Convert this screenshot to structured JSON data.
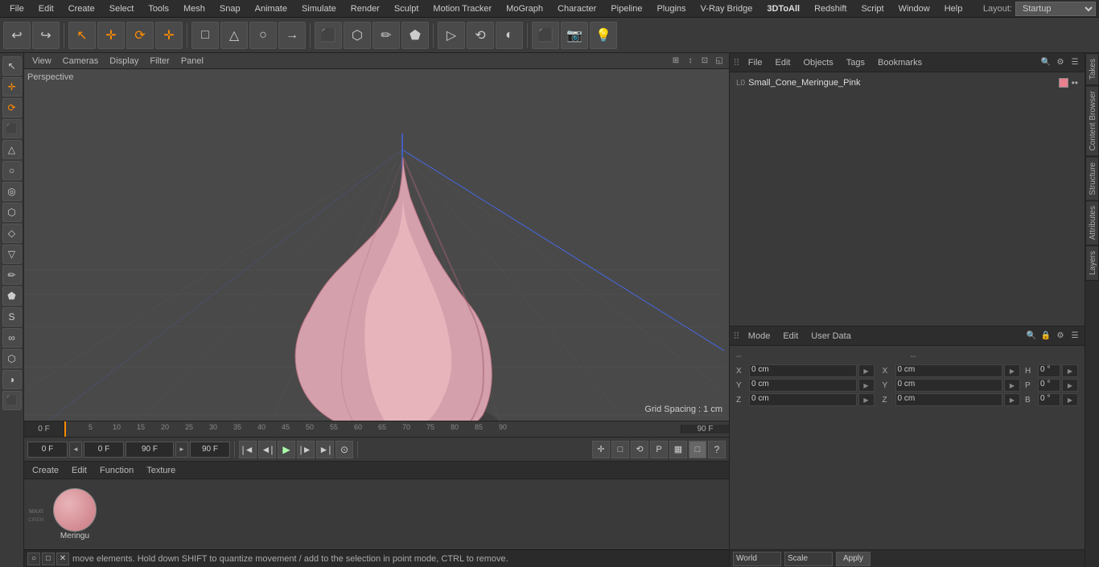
{
  "menubar": {
    "items": [
      "File",
      "Edit",
      "Create",
      "Select",
      "Tools",
      "Mesh",
      "Snap",
      "Animate",
      "Simulate",
      "Render",
      "Sculpt",
      "Motion Tracker",
      "MoGraph",
      "Character",
      "Pipeline",
      "Plugins",
      "V-Ray Bridge",
      "3DToAll",
      "Redshift",
      "Script",
      "Window",
      "Help"
    ],
    "layout_label": "Layout:",
    "layout_value": "Startup"
  },
  "toolbar": {
    "buttons": [
      "↩",
      "↪",
      "↖",
      "✛",
      "⟳",
      "✛",
      "□",
      "△",
      "○",
      "→",
      "⬛",
      "⬡",
      "✏",
      "⬟",
      "◈",
      "▷",
      "⟲",
      "◐",
      "☆",
      "⬛",
      "⬡",
      "◇",
      "▦",
      "📷",
      "💡"
    ]
  },
  "left_sidebar": {
    "buttons": [
      "↖",
      "✛",
      "⟳",
      "⬛",
      "△",
      "○",
      "◎",
      "⬡",
      "◇",
      "▽",
      "✏",
      "⬟",
      "S",
      "∞",
      "⬡",
      "◑",
      "⬛"
    ]
  },
  "viewport": {
    "label": "Perspective",
    "menu_items": [
      "View",
      "Cameras",
      "Display",
      "Filter",
      "Panel"
    ],
    "grid_spacing": "Grid Spacing : 1 cm"
  },
  "timeline": {
    "ticks": [
      0,
      5,
      10,
      15,
      20,
      25,
      30,
      35,
      40,
      45,
      50,
      55,
      60,
      65,
      70,
      75,
      80,
      85,
      90
    ],
    "current_frame_label": "0 F",
    "end_frame": "90 F"
  },
  "playback": {
    "start_frame": "0 F",
    "current_frame": "0 F",
    "end_frame": "90 F",
    "end_frame2": "90 F",
    "right_icons": [
      "⊞",
      "□",
      "⊡",
      "⊙",
      "P",
      "▦",
      "□"
    ]
  },
  "objects_panel": {
    "toolbar_items": [
      "File",
      "Edit",
      "Objects",
      "Tags",
      "Bookmarks"
    ],
    "scene_object": {
      "icon": "L0",
      "name": "Small_Cone_Meringue_Pink",
      "color": "#e88090"
    }
  },
  "attributes_panel": {
    "toolbar_items": [
      "Mode",
      "Edit",
      "User Data"
    ],
    "coord_headers": [
      "--",
      "--"
    ],
    "fields": {
      "x_pos": "0 cm",
      "y_pos": "0 cm",
      "z_pos": "0 cm",
      "x_rot": "0 cm",
      "y_rot": "0 cm",
      "z_rot": "0 cm",
      "p": "0 °",
      "h": "0 °",
      "b": "0 °"
    }
  },
  "coord_bar": {
    "world_label": "World",
    "scale_label": "Scale",
    "apply_label": "Apply"
  },
  "material_panel": {
    "toolbar_items": [
      "Create",
      "Edit",
      "Function",
      "Texture"
    ],
    "material_name": "Meringu"
  },
  "status_bar": {
    "message": "move elements. Hold down SHIFT to quantize movement / add to the selection in point mode, CTRL to remove."
  },
  "right_vtabs": [
    "Takes",
    "Content Browser",
    "Structure",
    "Attributes",
    "Layers"
  ]
}
